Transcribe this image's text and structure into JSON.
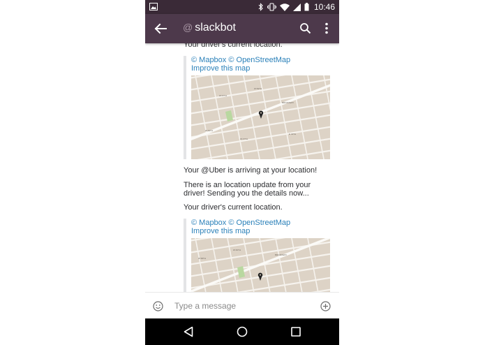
{
  "status_bar": {
    "time": "10:46",
    "icons": [
      "image-icon",
      "bluetooth-icon",
      "vibrate-icon",
      "wifi-icon",
      "cell-signal-icon",
      "battery-icon"
    ]
  },
  "app_bar": {
    "at_symbol": "@",
    "channel": "slackbot",
    "icons": [
      "back-arrow-icon",
      "search-icon",
      "more-vert-icon"
    ]
  },
  "messages": {
    "driver_location_1": "Your driver's current location.",
    "attachment_1": {
      "credits": "© Mapbox © OpenStreetMap",
      "improve": "Improve this map"
    },
    "arriving": "Your @Uber is arriving at your location!",
    "update_line1": "There is an location update from your",
    "update_line2": "driver! Sending you the details now...",
    "driver_location_2": "Your driver's current location.",
    "attachment_2": {
      "credits": "© Mapbox © OpenStreetMap",
      "improve": "Improve this map"
    }
  },
  "composer": {
    "placeholder": "Type a message"
  },
  "colors": {
    "status_bar": "#3a2a37",
    "app_bar": "#4d394b",
    "link": "#2a80b9",
    "map_land": "#ddd3c6",
    "map_road": "#f6f3ee",
    "map_park": "#b9d8a0"
  }
}
